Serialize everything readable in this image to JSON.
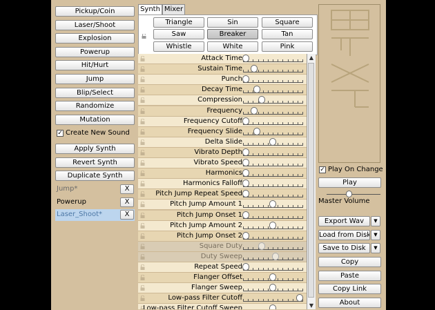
{
  "left_buttons": [
    {
      "label": "Pickup/Coin"
    },
    {
      "label": "Laser/Shoot"
    },
    {
      "label": "Explosion"
    },
    {
      "label": "Powerup"
    },
    {
      "label": "Hit/Hurt"
    },
    {
      "label": "Jump"
    },
    {
      "label": "Blip/Select"
    },
    {
      "label": "Randomize"
    },
    {
      "label": "Mutation"
    }
  ],
  "create_new_sound": {
    "label": "Create New Sound",
    "checked": true,
    "mark": "✓"
  },
  "synth_buttons": [
    {
      "label": "Apply Synth"
    },
    {
      "label": "Revert Synth"
    },
    {
      "label": "Duplicate Synth"
    }
  ],
  "sound_list": [
    {
      "name": "Jump*",
      "remove": "X",
      "style": "dim"
    },
    {
      "name": "Powerup",
      "remove": "X",
      "style": "normal"
    },
    {
      "name": "Laser_Shoot*",
      "remove": "X",
      "style": "selected"
    }
  ],
  "tabs": [
    {
      "label": "Synth",
      "active": true
    },
    {
      "label": "Mixer",
      "active": false
    }
  ],
  "waveforms": [
    {
      "label": "Triangle",
      "selected": false
    },
    {
      "label": "Sin",
      "selected": false
    },
    {
      "label": "Square",
      "selected": false
    },
    {
      "label": "Saw",
      "selected": false
    },
    {
      "label": "Breaker",
      "selected": true
    },
    {
      "label": "Tan",
      "selected": false
    },
    {
      "label": "Whistle",
      "selected": false
    },
    {
      "label": "White",
      "selected": false
    },
    {
      "label": "Pink",
      "selected": false
    }
  ],
  "params": [
    {
      "label": "Attack Time",
      "value": 0.0,
      "disabled": false
    },
    {
      "label": "Sustain Time",
      "value": 0.15,
      "disabled": false
    },
    {
      "label": "Punch",
      "value": 0.0,
      "disabled": false
    },
    {
      "label": "Decay Time",
      "value": 0.2,
      "disabled": false
    },
    {
      "label": "Compression",
      "value": 0.3,
      "disabled": false
    },
    {
      "label": "Frequency",
      "value": 0.15,
      "disabled": false
    },
    {
      "label": "Frequency Cutoff",
      "value": 0.0,
      "disabled": false
    },
    {
      "label": "Frequency Slide",
      "value": 0.2,
      "disabled": false
    },
    {
      "label": "Delta Slide",
      "value": 0.5,
      "disabled": false
    },
    {
      "label": "Vibrato Depth",
      "value": 0.0,
      "disabled": false
    },
    {
      "label": "Vibrato Speed",
      "value": 0.0,
      "disabled": false
    },
    {
      "label": "Harmonics",
      "value": 0.0,
      "disabled": false
    },
    {
      "label": "Harmonics Falloff",
      "value": 0.0,
      "disabled": false
    },
    {
      "label": "Pitch Jump Repeat Speed",
      "value": 0.0,
      "disabled": false
    },
    {
      "label": "Pitch Jump Amount 1",
      "value": 0.5,
      "disabled": false
    },
    {
      "label": "Pitch Jump Onset 1",
      "value": 0.0,
      "disabled": false
    },
    {
      "label": "Pitch Jump Amount 2",
      "value": 0.5,
      "disabled": false
    },
    {
      "label": "Pitch Jump Onset 2",
      "value": 0.0,
      "disabled": false
    },
    {
      "label": "Square Duty",
      "value": 0.3,
      "disabled": true
    },
    {
      "label": "Duty Sweep",
      "value": 0.55,
      "disabled": true
    },
    {
      "label": "Repeat Speed",
      "value": 0.0,
      "disabled": false
    },
    {
      "label": "Flanger Offset",
      "value": 0.5,
      "disabled": false
    },
    {
      "label": "Flanger Sweep",
      "value": 0.5,
      "disabled": false
    },
    {
      "label": "Low-pass Filter Cutoff",
      "value": 1.0,
      "disabled": false
    },
    {
      "label": "Low-pass Filter Cutoff Sweep",
      "value": 0.5,
      "disabled": false
    }
  ],
  "scroll": {
    "up": "▲",
    "down": "▼"
  },
  "logo": {
    "text": "Bfxr"
  },
  "play_on_change": {
    "label": "Play On Change",
    "checked": true,
    "mark": "✓"
  },
  "play_button": "Play",
  "master_volume": {
    "label": "Master Volume",
    "value": 0.4
  },
  "file_buttons": [
    {
      "label": "Export Wav",
      "arrow": "▼"
    },
    {
      "label": "Load from Disk",
      "arrow": "▼"
    },
    {
      "label": "Save to Disk",
      "arrow": "▼"
    }
  ],
  "util_buttons": [
    {
      "label": "Copy"
    },
    {
      "label": "Paste"
    },
    {
      "label": "Copy Link"
    },
    {
      "label": "About"
    }
  ]
}
